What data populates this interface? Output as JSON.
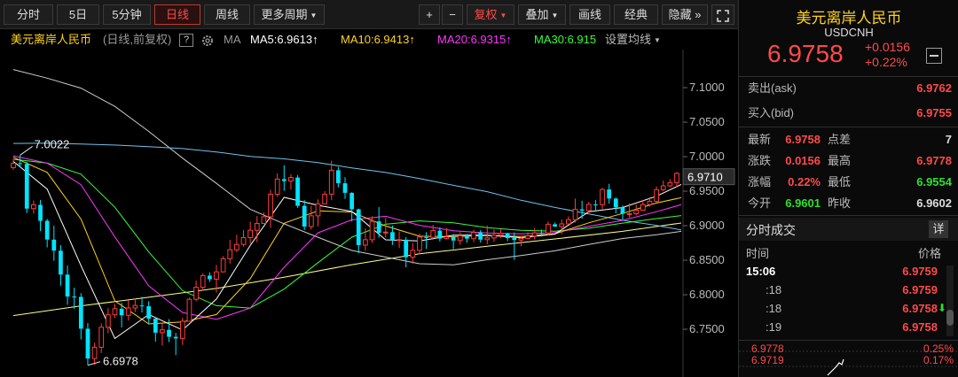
{
  "toolbar": {
    "periods": [
      "分时",
      "5日",
      "5分钟",
      "日线",
      "周线",
      "更多周期"
    ],
    "tools": [
      "+",
      "−",
      "复权",
      "叠加",
      "画线",
      "经典",
      "隐藏"
    ],
    "expand_glyph": "»"
  },
  "ma_bar": {
    "title": "美元离岸人民币",
    "mode": "(日线,前复权)",
    "help": "?",
    "ma_label": "MA",
    "ma5": "MA5:6.9613",
    "ma10": "MA10:6.9413",
    "ma20": "MA20:6.9315",
    "ma30": "MA30:6.915",
    "arrow": "↑",
    "settings": "设置均线",
    "colors": {
      "ma5": "#ffffff",
      "ma10": "#ffd21e",
      "ma20": "#ff36ff",
      "ma30": "#36ff36"
    }
  },
  "quote": {
    "name": "美元离岸人民币",
    "code": "USDCNH",
    "price": "6.9758",
    "change": "+0.0156",
    "change_pct": "+0.22%",
    "ask_label": "卖出(ask)",
    "ask": "6.9762",
    "bid_label": "买入(bid)",
    "bid": "6.9755",
    "stats": [
      {
        "l1": "最新",
        "v1": "6.9758",
        "c1": "r",
        "l2": "点差",
        "v2": "7",
        "c2": "w"
      },
      {
        "l1": "涨跌",
        "v1": "0.0156",
        "c1": "r",
        "l2": "最高",
        "v2": "6.9778",
        "c2": "r"
      },
      {
        "l1": "涨幅",
        "v1": "0.22%",
        "c1": "r",
        "l2": "最低",
        "v2": "6.9554",
        "c2": "g"
      },
      {
        "l1": "今开",
        "v1": "6.9601",
        "c1": "g",
        "l2": "昨收",
        "v2": "6.9602",
        "c2": "w"
      }
    ]
  },
  "ticks": {
    "title": "分时成交",
    "detail_button": "详",
    "col_time": "时间",
    "col_price": "价格",
    "rows": [
      {
        "t": "15:06",
        "p": "6.9759"
      },
      {
        "t": ":18",
        "p": "6.9759"
      },
      {
        "t": ":18",
        "p": "6.9758",
        "down": "⬇"
      },
      {
        "t": ":19",
        "p": "6.9758"
      }
    ]
  },
  "mini": {
    "high": "6.9778",
    "high_pct": "0.25%",
    "low": "6.9719",
    "low_pct": "0.17%"
  },
  "chart_data": {
    "type": "candlestick",
    "y_ticks": [
      7.1,
      7.05,
      7.0,
      6.95,
      6.9,
      6.85,
      6.8,
      6.75
    ],
    "ylim": [
      6.6808,
      7.1552
    ],
    "last_price": 6.971,
    "annotations": {
      "high": "7.0022",
      "low": "6.6978"
    },
    "colors": {
      "up": "#ff3c3c",
      "down": "#00e5ff",
      "ma5": "#ffffff",
      "ma10": "#ffd21e",
      "ma20": "#ff36ff",
      "ma30": "#36ff36",
      "ma60": "#6ec4ee",
      "ma120": "#cccccc",
      "ma250": "#ffff88"
    },
    "candles": [
      [
        6.9842,
        6.9969,
        6.9811,
        6.9905
      ],
      [
        6.9905,
        7.0022,
        6.9843,
        6.9895
      ],
      [
        6.9895,
        6.9923,
        6.9183,
        6.9247
      ],
      [
        6.9247,
        6.9366,
        6.9175,
        6.9302
      ],
      [
        6.9302,
        6.9373,
        6.8923,
        6.9071
      ],
      [
        6.9071,
        6.9099,
        6.8686,
        6.8799
      ],
      [
        6.8799,
        6.8999,
        6.8491,
        6.8639
      ],
      [
        6.8639,
        6.872,
        6.8131,
        6.8292
      ],
      [
        6.8292,
        6.8423,
        6.7854,
        6.7974
      ],
      [
        6.7974,
        6.8102,
        6.7796,
        6.7969
      ],
      [
        6.7969,
        6.8023,
        6.7352,
        6.7508
      ],
      [
        6.7508,
        6.7589,
        6.6978,
        6.7075
      ],
      [
        6.7075,
        6.7304,
        6.6987,
        6.7239
      ],
      [
        6.7239,
        6.7585,
        6.7156,
        6.7529
      ],
      [
        6.7529,
        6.7805,
        6.7443,
        6.7709
      ],
      [
        6.7709,
        6.787,
        6.7663,
        6.7797
      ],
      [
        6.7797,
        6.7882,
        6.7527,
        6.7702
      ],
      [
        6.7702,
        6.792,
        6.7626,
        6.7808
      ],
      [
        6.7808,
        6.7945,
        6.7749,
        6.7845
      ],
      [
        6.7845,
        6.797,
        6.7743,
        6.7833
      ],
      [
        6.7833,
        6.7906,
        6.7574,
        6.7653
      ],
      [
        6.7653,
        6.7664,
        6.7319,
        6.745
      ],
      [
        6.745,
        6.7578,
        6.7264,
        6.7492
      ],
      [
        6.7492,
        6.7646,
        6.7314,
        6.739
      ],
      [
        6.739,
        6.7449,
        6.7126,
        6.7367
      ],
      [
        6.7367,
        6.7666,
        6.7272,
        6.7616
      ],
      [
        6.7616,
        6.796,
        6.7609,
        6.7934
      ],
      [
        6.7934,
        6.8205,
        6.7905,
        6.8108
      ],
      [
        6.8108,
        6.8308,
        6.8058,
        6.8277
      ],
      [
        6.8277,
        6.8325,
        6.8185,
        6.8225
      ],
      [
        6.8225,
        6.8432,
        6.8032,
        6.8331
      ],
      [
        6.8331,
        6.8559,
        6.8322,
        6.8521
      ],
      [
        6.8521,
        6.8797,
        6.8451,
        6.8651
      ],
      [
        6.8651,
        6.887,
        6.8617,
        6.8729
      ],
      [
        6.8729,
        6.8936,
        6.8696,
        6.8828
      ],
      [
        6.8828,
        6.906,
        6.8742,
        6.8934
      ],
      [
        6.8934,
        6.914,
        6.876,
        6.9033
      ],
      [
        6.9033,
        6.9194,
        6.9026,
        6.913
      ],
      [
        6.913,
        6.9522,
        6.8969,
        6.9455
      ],
      [
        6.9455,
        6.9757,
        6.9417,
        6.9675
      ],
      [
        6.9675,
        6.9876,
        6.9506,
        6.9647
      ],
      [
        6.9647,
        6.9745,
        6.9524,
        6.9698
      ],
      [
        6.9698,
        6.9735,
        6.9258,
        6.9288
      ],
      [
        6.9288,
        6.937,
        6.8938,
        6.8987
      ],
      [
        6.8987,
        6.9289,
        6.8944,
        6.9143
      ],
      [
        6.9143,
        6.9382,
        6.899,
        6.9317
      ],
      [
        6.9317,
        6.95,
        6.9315,
        6.9457
      ],
      [
        6.9457,
        6.9942,
        6.937,
        6.9803
      ],
      [
        6.9803,
        6.9851,
        6.9555,
        6.9615
      ],
      [
        6.9615,
        6.9702,
        6.9389,
        6.9476
      ],
      [
        6.9476,
        6.9486,
        6.9062,
        6.9238
      ],
      [
        6.9238,
        6.9247,
        6.8602,
        6.8719
      ],
      [
        6.8719,
        6.8965,
        6.8637,
        6.8797
      ],
      [
        6.8797,
        6.9136,
        6.8753,
        6.9063
      ],
      [
        6.9063,
        6.9271,
        6.8826,
        6.8897
      ],
      [
        6.8897,
        6.9113,
        6.8828,
        6.8907
      ],
      [
        6.8907,
        6.9003,
        6.8722,
        6.8793
      ],
      [
        6.8793,
        6.8917,
        6.8677,
        6.8798
      ],
      [
        6.8798,
        6.8836,
        6.8397,
        6.8543
      ],
      [
        6.8543,
        6.8749,
        6.845,
        6.8643
      ],
      [
        6.8643,
        6.8885,
        6.8586,
        6.8835
      ],
      [
        6.8835,
        6.8906,
        6.8664,
        6.8832
      ],
      [
        6.8832,
        6.9012,
        6.8797,
        6.8929
      ],
      [
        6.8929,
        6.8978,
        6.8771,
        6.8813
      ],
      [
        6.8813,
        6.8967,
        6.8801,
        6.8837
      ],
      [
        6.8837,
        6.8879,
        6.8663,
        6.8785
      ],
      [
        6.8785,
        6.8905,
        6.8725,
        6.8854
      ],
      [
        6.8854,
        6.8879,
        6.8753,
        6.8812
      ],
      [
        6.8812,
        6.8943,
        6.8762,
        6.8903
      ],
      [
        6.8903,
        6.8936,
        6.8757,
        6.8798
      ],
      [
        6.8798,
        6.9002,
        6.8732,
        6.8823
      ],
      [
        6.8823,
        6.8947,
        6.8767,
        6.8862
      ],
      [
        6.8862,
        6.8955,
        6.8819,
        6.8889
      ],
      [
        6.8889,
        6.8898,
        6.8777,
        6.8821
      ],
      [
        6.8821,
        6.8901,
        6.8505,
        6.8792
      ],
      [
        6.8792,
        6.8847,
        6.8703,
        6.8816
      ],
      [
        6.8816,
        6.8903,
        6.8801,
        6.8851
      ],
      [
        6.8851,
        6.8963,
        6.8801,
        6.8896
      ],
      [
        6.8896,
        6.8946,
        6.8842,
        6.8895
      ],
      [
        6.8895,
        6.9061,
        6.8862,
        6.9021
      ],
      [
        6.9021,
        6.9046,
        6.8987,
        6.8986
      ],
      [
        6.8986,
        6.909,
        6.8876,
        6.9026
      ],
      [
        6.9026,
        6.9135,
        6.9017,
        6.9087
      ],
      [
        6.9087,
        6.9392,
        6.9046,
        6.9237
      ],
      [
        6.9237,
        6.9362,
        6.9104,
        6.9219
      ],
      [
        6.9219,
        6.9346,
        6.9187,
        6.9309
      ],
      [
        6.9309,
        6.9371,
        6.9203,
        6.9304
      ],
      [
        6.9304,
        6.9546,
        6.9239,
        6.9525
      ],
      [
        6.9525,
        6.9607,
        6.9318,
        6.9393
      ],
      [
        6.9393,
        6.9409,
        6.918,
        6.9265
      ],
      [
        6.9265,
        6.9293,
        6.9085,
        6.9174
      ],
      [
        6.9174,
        6.9326,
        6.9118,
        6.9174
      ],
      [
        6.9174,
        6.9307,
        6.9149,
        6.9225
      ],
      [
        6.9225,
        6.9375,
        6.922,
        6.9306
      ],
      [
        6.9306,
        6.9414,
        6.9279,
        6.9354
      ],
      [
        6.9354,
        6.957,
        6.9339,
        6.9522
      ],
      [
        6.9522,
        6.9654,
        6.9501,
        6.9577
      ],
      [
        6.9577,
        6.9674,
        6.9557,
        6.9624
      ],
      [
        6.9624,
        6.9778,
        6.9554,
        6.9758
      ]
    ],
    "ma_lines": {
      "ma5": [
        [
          0,
          6.9932
        ],
        [
          5,
          6.953
        ],
        [
          10,
          6.8421
        ],
        [
          15,
          6.7367
        ],
        [
          20,
          6.7713
        ],
        [
          25,
          6.7489
        ],
        [
          30,
          6.7937
        ],
        [
          35,
          6.8713
        ],
        [
          40,
          6.9411
        ],
        [
          45,
          6.9296
        ],
        [
          50,
          6.9207
        ],
        [
          55,
          6.8795
        ],
        [
          60,
          6.8779
        ],
        [
          65,
          6.8862
        ],
        [
          70,
          6.8862
        ],
        [
          75,
          6.8826
        ],
        [
          80,
          6.8879
        ],
        [
          85,
          6.9203
        ],
        [
          90,
          6.9263
        ],
        [
          95,
          6.9428
        ],
        [
          99,
          6.9613
        ]
      ],
      "ma10": [
        [
          0,
          6.9992
        ],
        [
          5,
          6.9772
        ],
        [
          10,
          6.9095
        ],
        [
          15,
          6.7911
        ],
        [
          20,
          6.7577
        ],
        [
          25,
          6.7607
        ],
        [
          30,
          6.7713
        ],
        [
          35,
          6.8232
        ],
        [
          40,
          6.9035
        ],
        [
          45,
          6.9216
        ],
        [
          50,
          6.9198
        ],
        [
          55,
          6.8995
        ],
        [
          60,
          6.8848
        ],
        [
          65,
          6.8842
        ],
        [
          70,
          6.8858
        ],
        [
          75,
          6.8844
        ],
        [
          80,
          6.8883
        ],
        [
          85,
          6.9042
        ],
        [
          90,
          6.9178
        ],
        [
          95,
          6.9329
        ],
        [
          99,
          6.9413
        ]
      ],
      "ma20": [
        [
          0,
          7.0012
        ],
        [
          5,
          6.9907
        ],
        [
          10,
          6.9594
        ],
        [
          15,
          6.8837
        ],
        [
          20,
          6.8129
        ],
        [
          25,
          6.7743
        ],
        [
          30,
          6.7643
        ],
        [
          35,
          6.7807
        ],
        [
          40,
          6.8398
        ],
        [
          45,
          6.8897
        ],
        [
          50,
          6.9085
        ],
        [
          55,
          6.9136
        ],
        [
          60,
          6.9006
        ],
        [
          65,
          6.8927
        ],
        [
          70,
          6.8894
        ],
        [
          75,
          6.8882
        ],
        [
          80,
          6.8902
        ],
        [
          85,
          6.8991
        ],
        [
          90,
          6.9078
        ],
        [
          95,
          6.9203
        ],
        [
          99,
          6.9315
        ]
      ],
      "ma30": [
        [
          0,
          6.9962
        ],
        [
          5,
          6.9907
        ],
        [
          10,
          6.9747
        ],
        [
          15,
          6.9267
        ],
        [
          20,
          6.862
        ],
        [
          25,
          6.8059
        ],
        [
          30,
          6.7842
        ],
        [
          35,
          6.7807
        ],
        [
          40,
          6.8081
        ],
        [
          45,
          6.8464
        ],
        [
          50,
          6.8834
        ],
        [
          55,
          6.9021
        ],
        [
          60,
          6.907
        ],
        [
          65,
          6.9043
        ],
        [
          70,
          6.8971
        ],
        [
          75,
          6.8934
        ],
        [
          80,
          6.8921
        ],
        [
          85,
          6.8963
        ],
        [
          90,
          6.9038
        ],
        [
          95,
          6.9103
        ],
        [
          99,
          6.915
        ]
      ],
      "ma60": [
        [
          0,
          7.0192
        ],
        [
          5,
          7.0197
        ],
        [
          10,
          7.0184
        ],
        [
          15,
          7.0168
        ],
        [
          20,
          7.0146
        ],
        [
          25,
          7.0117
        ],
        [
          30,
          7.0068
        ],
        [
          35,
          7.0004
        ],
        [
          40,
          6.9969
        ],
        [
          45,
          6.9914
        ],
        [
          50,
          6.9838
        ],
        [
          55,
          6.9771
        ],
        [
          60,
          6.9683
        ],
        [
          65,
          6.9585
        ],
        [
          70,
          6.9493
        ],
        [
          75,
          6.9368
        ],
        [
          80,
          6.9264
        ],
        [
          85,
          6.9171
        ],
        [
          90,
          6.9079
        ],
        [
          95,
          6.9004
        ],
        [
          99,
          6.8933
        ]
      ],
      "ma120": [
        [
          0,
          7.1262
        ],
        [
          5,
          7.1138
        ],
        [
          10,
          7.0993
        ],
        [
          15,
          7.0729
        ],
        [
          20,
          7.0366
        ],
        [
          25,
          6.9979
        ],
        [
          30,
          6.9614
        ],
        [
          35,
          6.9239
        ],
        [
          40,
          6.9028
        ],
        [
          45,
          6.8833
        ],
        [
          50,
          6.8641
        ],
        [
          55,
          6.8545
        ],
        [
          60,
          6.8449
        ],
        [
          65,
          6.8434
        ],
        [
          70,
          6.8507
        ],
        [
          75,
          6.8568
        ],
        [
          80,
          6.8637
        ],
        [
          85,
          6.8729
        ],
        [
          90,
          6.8814
        ],
        [
          95,
          6.8868
        ],
        [
          99,
          6.8923
        ]
      ],
      "ma250": [
        [
          0,
          6.7698
        ],
        [
          10,
          6.7839
        ],
        [
          20,
          6.7963
        ],
        [
          30,
          6.8092
        ],
        [
          40,
          6.8253
        ],
        [
          50,
          6.8435
        ],
        [
          60,
          6.8593
        ],
        [
          70,
          6.8702
        ],
        [
          80,
          6.8808
        ],
        [
          90,
          6.8919
        ],
        [
          99,
          6.9044
        ]
      ]
    }
  }
}
